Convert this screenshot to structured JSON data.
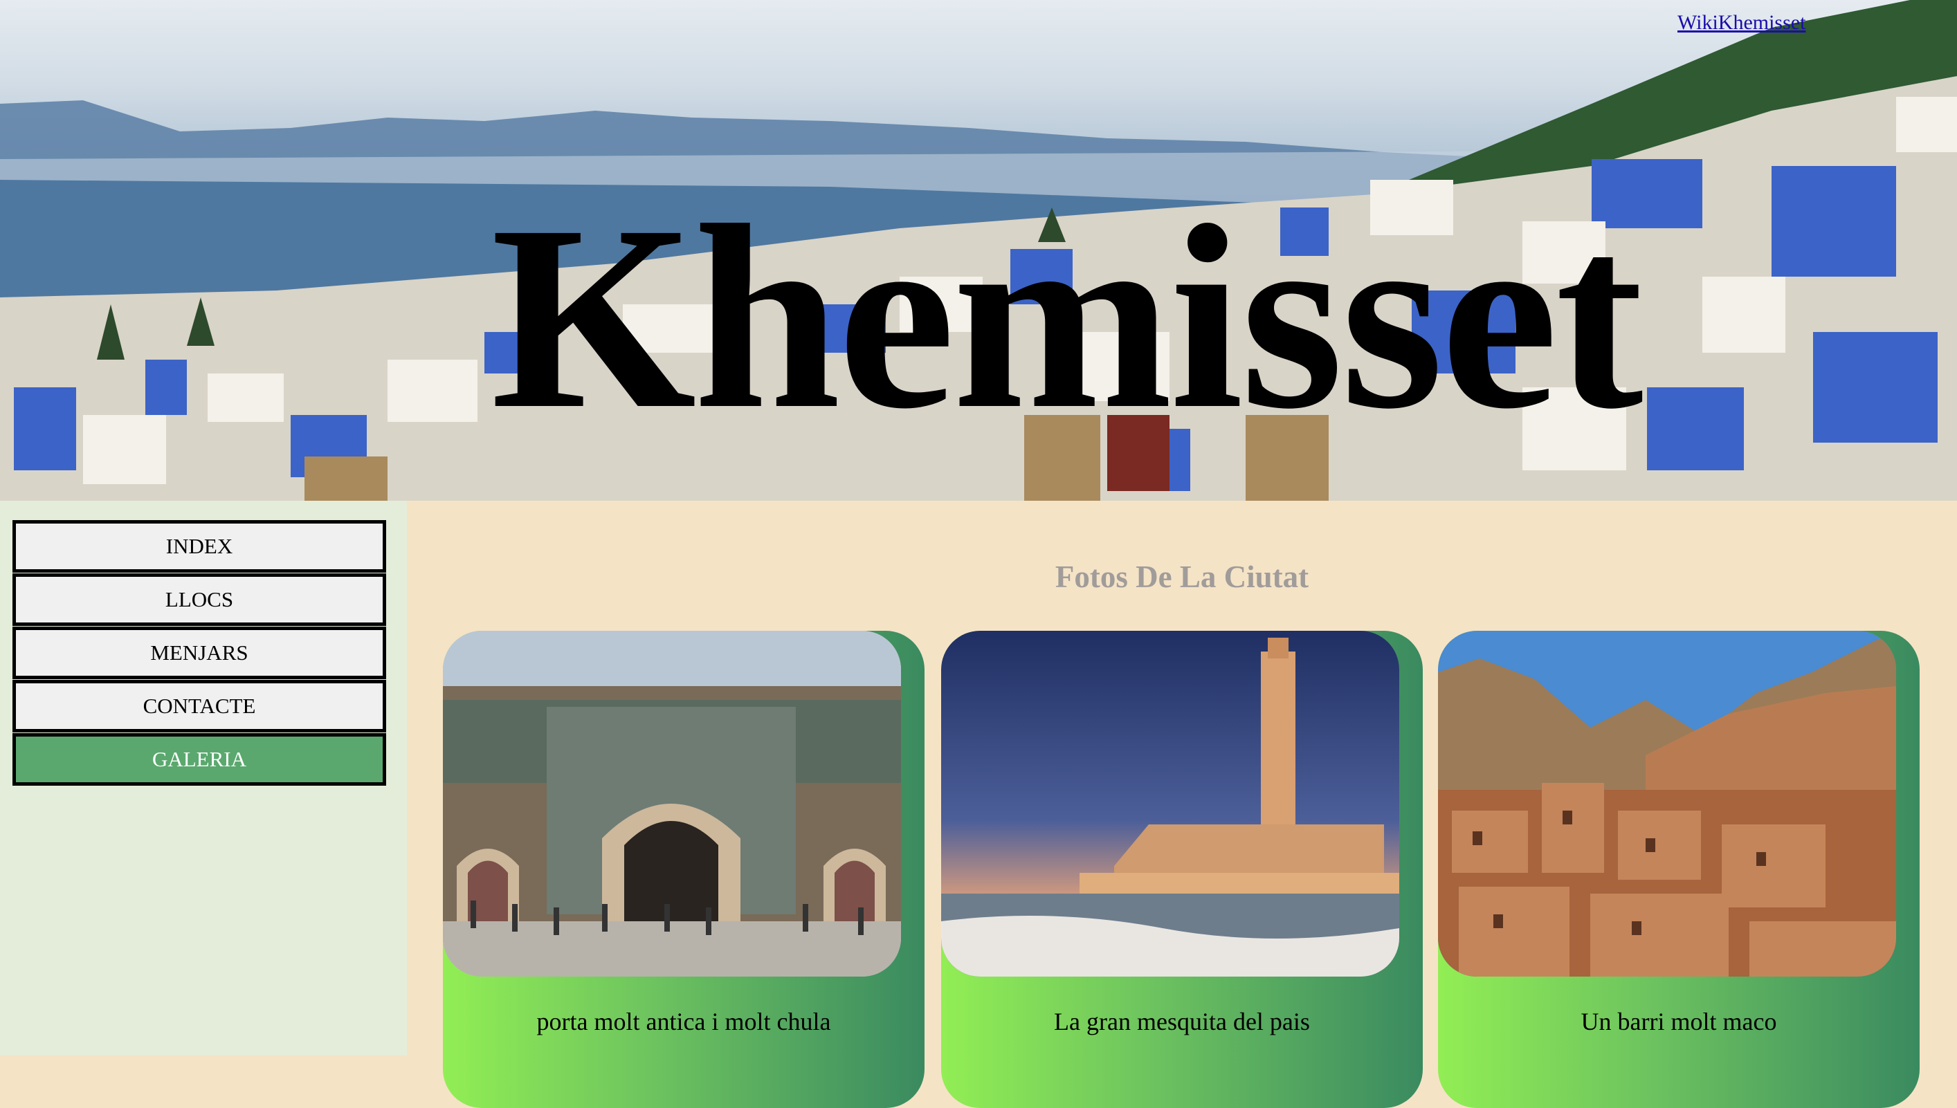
{
  "header": {
    "site_title": "Khemisset",
    "wiki_link": "WikiKhemisset"
  },
  "sidebar": {
    "items": [
      {
        "label": "INDEX",
        "active": false
      },
      {
        "label": "LLOCS",
        "active": false
      },
      {
        "label": "MENJARS",
        "active": false
      },
      {
        "label": "CONTACTE",
        "active": false
      },
      {
        "label": "GALERIA",
        "active": true
      }
    ]
  },
  "main": {
    "gallery_title": "Fotos De La Ciutat",
    "cards": [
      {
        "caption": "porta molt antica i molt chula",
        "image": "ornate-city-gate-photo"
      },
      {
        "caption": "La gran mesquita del pais",
        "image": "mosque-minaret-seaside-photo"
      },
      {
        "caption": "Un barri molt maco",
        "image": "mud-brick-village-photo"
      }
    ]
  },
  "colors": {
    "sidebar_bg": "#e4edd9",
    "main_bg": "#f5e3c6",
    "nav_active_bg": "#5aa86e",
    "title_gray": "#a09c9a",
    "card_gradient_start": "#92ee54",
    "card_gradient_end": "#3a8a60",
    "link_blue": "#1a0dab"
  }
}
